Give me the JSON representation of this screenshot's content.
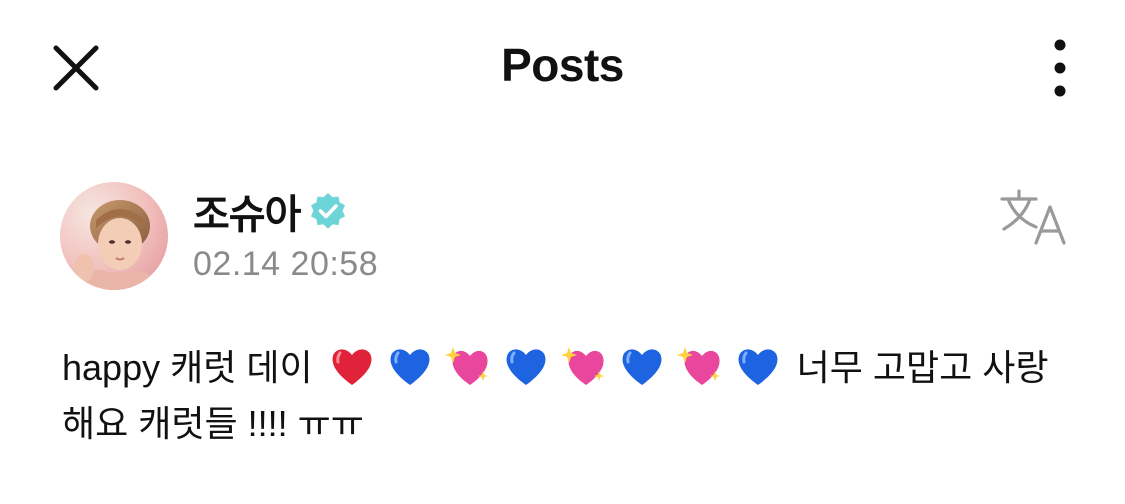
{
  "header": {
    "title": "Posts",
    "close_icon": "close-icon",
    "more_icon": "more-vertical-icon"
  },
  "post": {
    "author": "조슈아",
    "verified_icon": "verified-badge-icon",
    "timestamp": "02.14 20:58",
    "translate_icon": "translate-icon",
    "avatar_icon": "avatar",
    "text_start": "happy 캐럿 데이",
    "emojis": [
      "red-heart",
      "blue-heart",
      "sparkling-heart",
      "blue-heart",
      "sparkling-heart",
      "blue-heart",
      "sparkling-heart",
      "blue-heart"
    ],
    "text_end": "너무 고맙고 사랑해요 캐럿들 !!!! ㅠㅠ"
  },
  "colors": {
    "verified_badge": "#6dd5d8",
    "timestamp": "#8a8a8a",
    "translate_icon": "#9a9a9a",
    "red_heart": "#e0233b",
    "blue_heart": "#1e63e0",
    "sparkling_heart": "#e8479d"
  }
}
